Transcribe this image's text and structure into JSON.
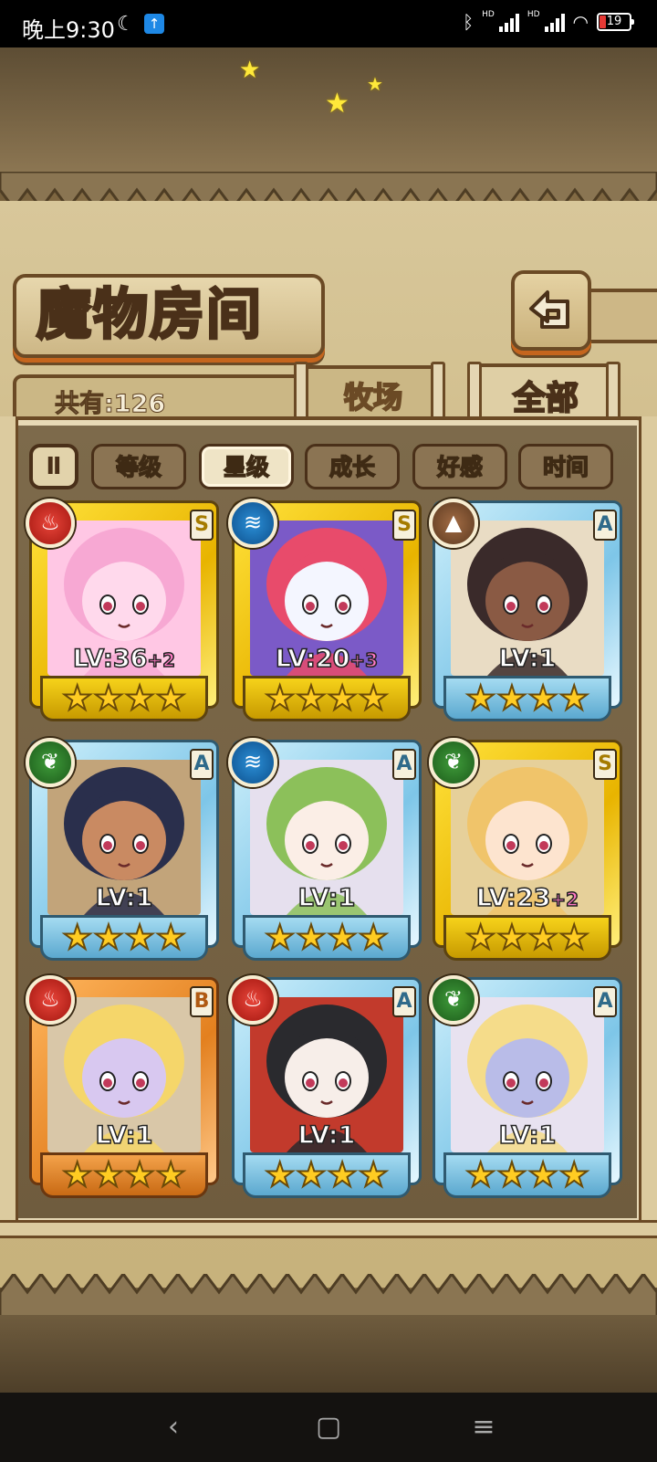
{
  "status_bar": {
    "time": "晚上9:30",
    "battery": "19",
    "icons": [
      "moon-icon",
      "upload-icon",
      "bluetooth-icon",
      "signal-hd-icon",
      "signal-hd-icon",
      "wifi-icon",
      "battery-icon"
    ]
  },
  "title": "魔物房间",
  "count_label": "共有:126",
  "tabs": [
    {
      "label": "牧场",
      "active": false
    },
    {
      "label": "全部",
      "active": true
    }
  ],
  "sort_toggle_label": "Ⅱ",
  "sort_buttons": [
    {
      "label": "等级",
      "active": false
    },
    {
      "label": "星级",
      "active": true
    },
    {
      "label": "成长",
      "active": false
    },
    {
      "label": "好感",
      "active": false
    },
    {
      "label": "时间",
      "active": false
    }
  ],
  "cards": [
    {
      "rank": "S",
      "element": "fire",
      "level": "LV:36",
      "bonus": "+2",
      "stars": 4,
      "colors": {
        "hair": "#f7a8d3",
        "skin": "#ffd9ec",
        "bg": "#ffc7e4"
      }
    },
    {
      "rank": "S",
      "element": "water",
      "level": "LV:20",
      "bonus": "+3",
      "stars": 4,
      "colors": {
        "hair": "#e84b6b",
        "skin": "#f4f6ff",
        "bg": "#7b5ac7"
      }
    },
    {
      "rank": "A",
      "element": "earth",
      "level": "LV:1",
      "bonus": "",
      "stars": 4,
      "colors": {
        "hair": "#3a2a2a",
        "skin": "#8a5a44",
        "bg": "#e9dcc4"
      }
    },
    {
      "rank": "A",
      "element": "wood",
      "level": "LV:1",
      "bonus": "",
      "stars": 4,
      "colors": {
        "hair": "#2a2f4c",
        "skin": "#c98a62",
        "bg": "#c2a47a"
      }
    },
    {
      "rank": "A",
      "element": "water",
      "level": "LV:1",
      "bonus": "",
      "stars": 4,
      "colors": {
        "hair": "#8cc05a",
        "skin": "#fbeee6",
        "bg": "#e6e0ee"
      }
    },
    {
      "rank": "S",
      "element": "wood",
      "level": "LV:23",
      "bonus": "+2",
      "stars": 4,
      "colors": {
        "hair": "#f0c46a",
        "skin": "#fde4cf",
        "bg": "#e6d09a"
      }
    },
    {
      "rank": "B",
      "element": "fire",
      "level": "LV:1",
      "bonus": "",
      "stars": 4,
      "colors": {
        "hair": "#f5d66a",
        "skin": "#d8c8f0",
        "bg": "#d9c7a8"
      }
    },
    {
      "rank": "A",
      "element": "fire",
      "level": "LV:1",
      "bonus": "",
      "stars": 4,
      "colors": {
        "hair": "#2a2a2e",
        "skin": "#f7eee9",
        "bg": "#c23a2c"
      }
    },
    {
      "rank": "A",
      "element": "wood",
      "level": "LV:1",
      "bonus": "",
      "stars": 4,
      "colors": {
        "hair": "#f5dc8a",
        "skin": "#b9bce8",
        "bg": "#e8e2f0"
      }
    }
  ],
  "nav": {
    "back": "‹",
    "home": "▢",
    "menu": "≡"
  }
}
